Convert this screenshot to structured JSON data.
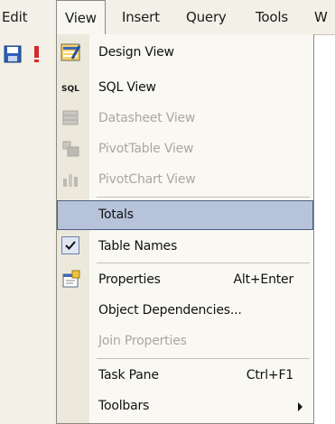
{
  "menubar": {
    "items": [
      "Edit",
      "View",
      "Insert",
      "Query",
      "Tools",
      "W"
    ]
  },
  "toolbar": {
    "icons": [
      "save-icon",
      "run-icon"
    ]
  },
  "menu": {
    "items": [
      {
        "label": "Design View",
        "icon": "design-view-icon",
        "enabled": true
      },
      {
        "label": "SQL View",
        "icon": "sql-view-icon",
        "icon_text": "SQL",
        "enabled": true
      },
      {
        "label": "Datasheet View",
        "icon": "datasheet-view-icon",
        "enabled": false
      },
      {
        "label": "PivotTable View",
        "icon": "pivottable-view-icon",
        "enabled": false
      },
      {
        "label": "PivotChart View",
        "icon": "pivotchart-view-icon",
        "enabled": false
      },
      {
        "label": "Totals",
        "enabled": true,
        "highlighted": true
      },
      {
        "label": "Table Names",
        "enabled": true,
        "checked": true
      },
      {
        "label": "Properties",
        "shortcut": "Alt+Enter",
        "icon": "properties-icon",
        "enabled": true
      },
      {
        "label": "Object Dependencies...",
        "enabled": true
      },
      {
        "label": "Join Properties",
        "enabled": false
      },
      {
        "label": "Task Pane",
        "shortcut": "Ctrl+F1",
        "enabled": true
      },
      {
        "label": "Toolbars",
        "enabled": true,
        "submenu": true
      }
    ]
  },
  "colors": {
    "highlight_fill": "#b7c3da",
    "highlight_border": "#4d5f88",
    "menu_bg": "#f9f8f3",
    "gutter_bg": "#ece9dc",
    "disabled_text": "#aaa7a0"
  }
}
